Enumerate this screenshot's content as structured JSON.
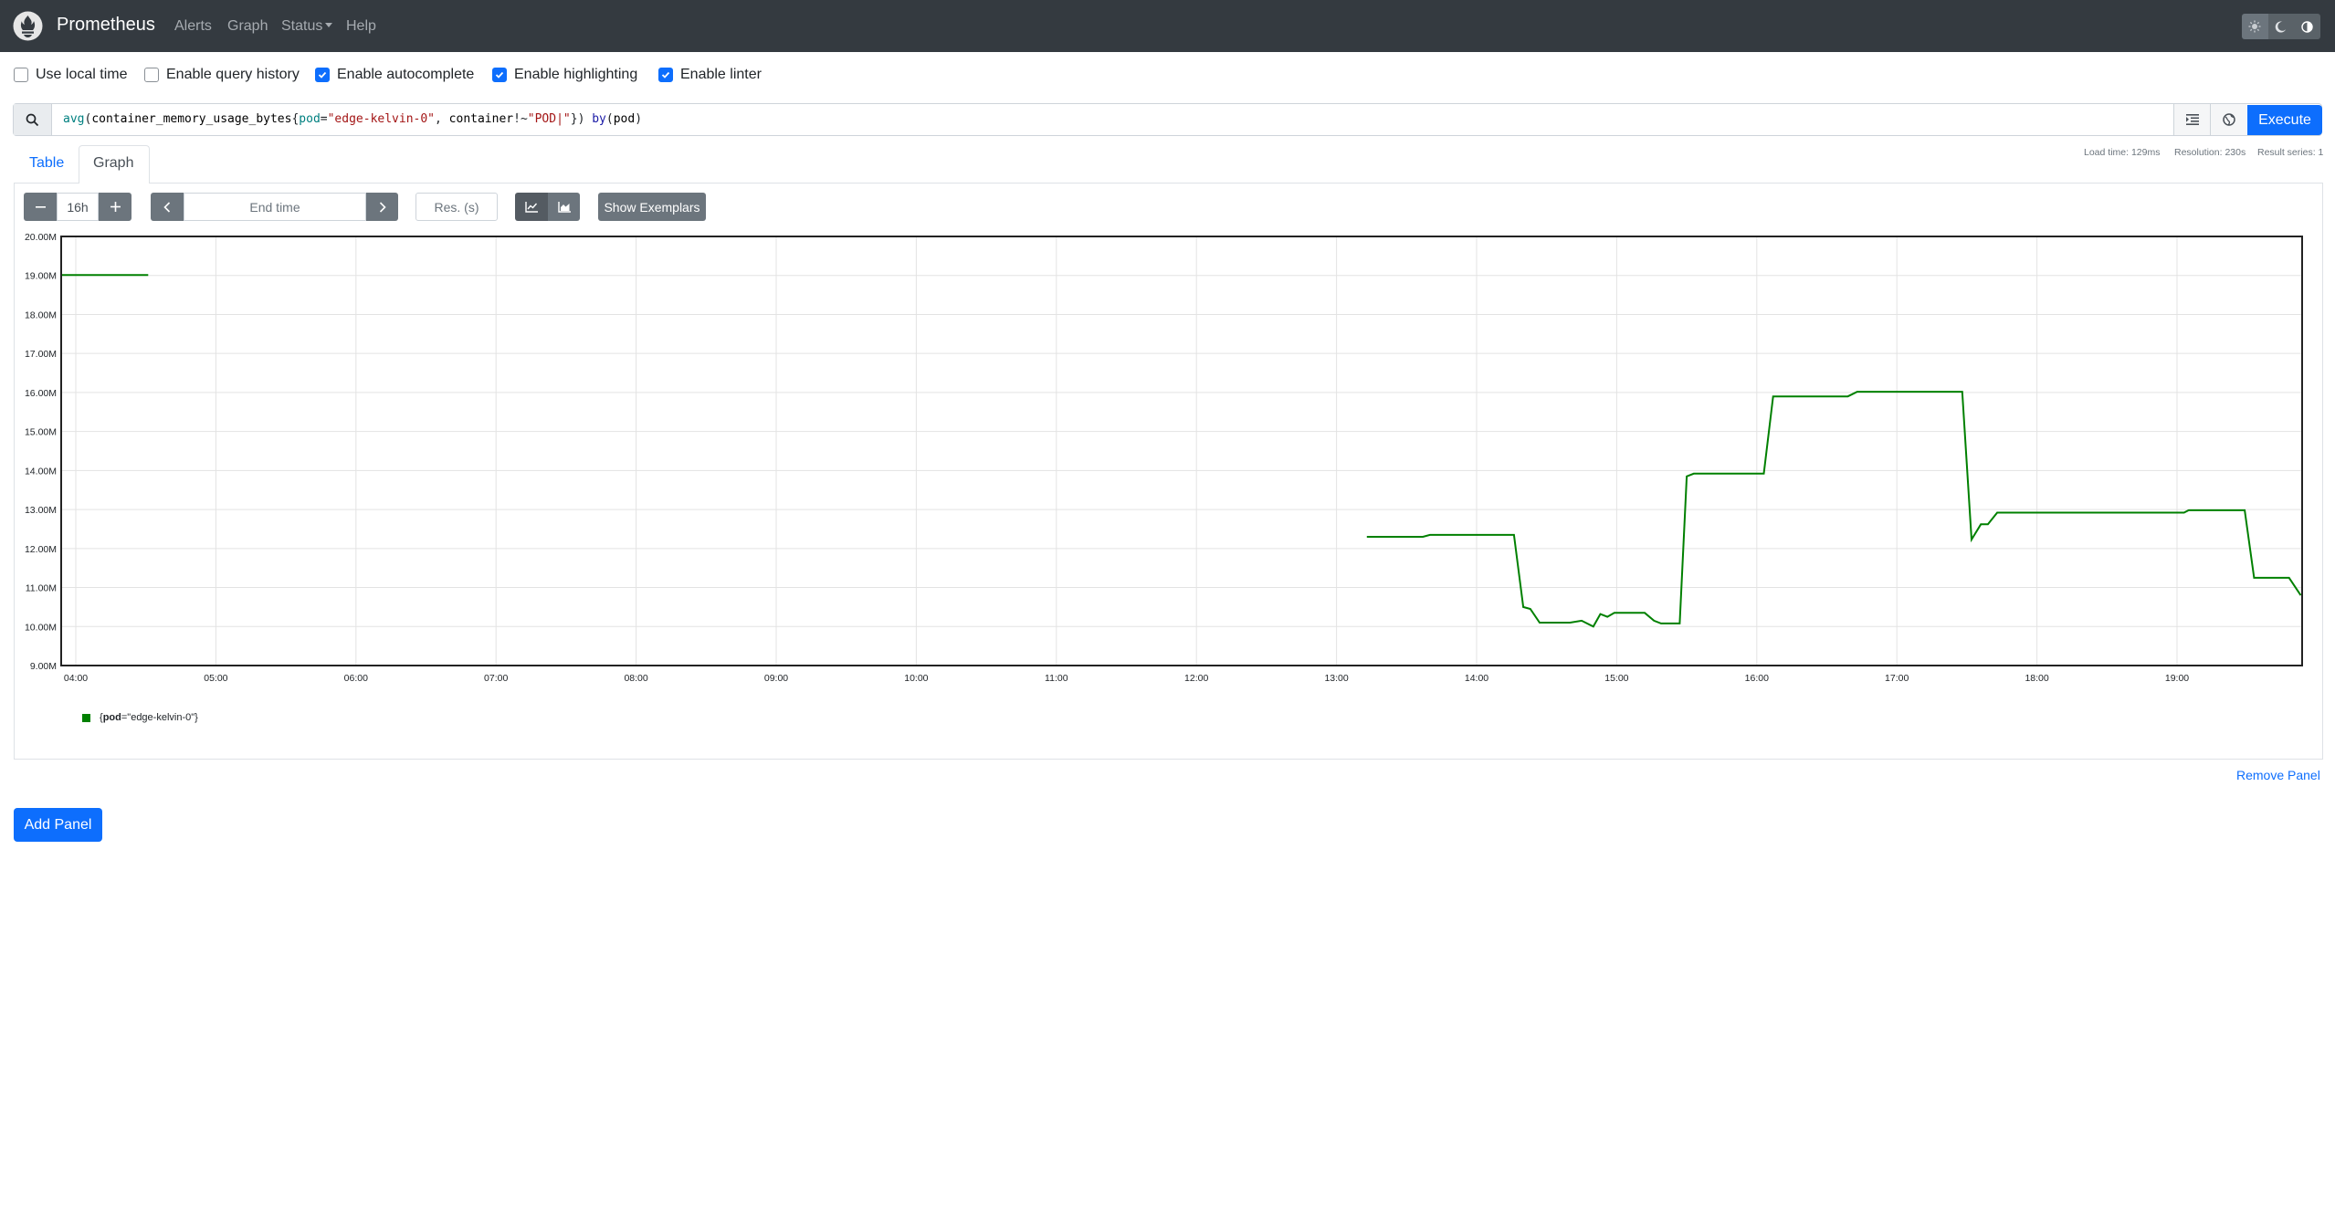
{
  "app": {
    "title": "Prometheus",
    "nav": [
      {
        "label": "Alerts"
      },
      {
        "label": "Graph"
      },
      {
        "label": "Status"
      },
      {
        "label": "Help"
      }
    ]
  },
  "options": [
    {
      "label": "Use local time",
      "checked": false
    },
    {
      "label": "Enable query history",
      "checked": false
    },
    {
      "label": "Enable autocomplete",
      "checked": true
    },
    {
      "label": "Enable highlighting",
      "checked": true
    },
    {
      "label": "Enable linter",
      "checked": true
    }
  ],
  "query": {
    "fn": "avg",
    "metric": "container_memory_usage_bytes",
    "label1": "pod",
    "value1": "\"edge-kelvin-0\"",
    "label2": "container",
    "op2": "!~",
    "value2": "\"POD|\"",
    "kw": "by",
    "group": "pod"
  },
  "execute_label": "Execute",
  "stats": {
    "load_time": "Load time: 129ms",
    "resolution": "Resolution: 230s",
    "result_series": "Result series: 1"
  },
  "tabs": [
    {
      "label": "Table"
    },
    {
      "label": "Graph"
    }
  ],
  "controls": {
    "range": "16h",
    "end_time_placeholder": "End time",
    "resolution_placeholder": "Res. (s)",
    "exemplars_label": "Show Exemplars"
  },
  "colors": {
    "series": "#008000",
    "accent": "#0d6efd",
    "navbar": "#343a40"
  },
  "chart_data": {
    "type": "line",
    "yticks": [
      "9.00M",
      "10.00M",
      "11.00M",
      "12.00M",
      "13.00M",
      "14.00M",
      "15.00M",
      "16.00M",
      "17.00M",
      "18.00M",
      "19.00M",
      "20.00M"
    ],
    "xticks": [
      "04:00",
      "05:00",
      "06:00",
      "07:00",
      "08:00",
      "09:00",
      "10:00",
      "11:00",
      "12:00",
      "13:00",
      "14:00",
      "15:00",
      "16:00",
      "17:00",
      "18:00",
      "19:00"
    ],
    "ylim": [
      9000000,
      20000000
    ],
    "grid": true,
    "legend": "bottom-left",
    "series": [
      {
        "name": "{pod=\"edge-kelvin-0\"}",
        "label_key": "pod",
        "label_value": "\"edge-kelvin-0\"",
        "segments": [
          [
            [
              "03:53",
              19010000
            ],
            [
              "04:31",
              19010000
            ]
          ],
          [
            [
              "13:13",
              12300000
            ],
            [
              "13:37",
              12300000
            ],
            [
              "13:40",
              12350000
            ],
            [
              "14:16",
              12350000
            ],
            [
              "14:20",
              10500000
            ],
            [
              "14:23",
              10450000
            ],
            [
              "14:27",
              10100000
            ],
            [
              "14:40",
              10100000
            ],
            [
              "14:45",
              10150000
            ],
            [
              "14:50",
              10000000
            ],
            [
              "14:53",
              10320000
            ],
            [
              "14:56",
              10250000
            ],
            [
              "14:59",
              10350000
            ],
            [
              "15:12",
              10350000
            ],
            [
              "15:16",
              10150000
            ],
            [
              "15:19",
              10080000
            ],
            [
              "15:27",
              10080000
            ],
            [
              "15:30",
              13850000
            ],
            [
              "15:33",
              13920000
            ],
            [
              "16:03",
              13920000
            ],
            [
              "16:07",
              15900000
            ],
            [
              "16:39",
              15900000
            ],
            [
              "16:43",
              16020000
            ],
            [
              "17:28",
              16020000
            ],
            [
              "17:32",
              12230000
            ],
            [
              "17:36",
              12620000
            ],
            [
              "17:39",
              12620000
            ],
            [
              "17:43",
              12920000
            ],
            [
              "19:03",
              12920000
            ],
            [
              "19:05",
              12980000
            ],
            [
              "19:29",
              12980000
            ],
            [
              "19:33",
              11250000
            ],
            [
              "19:48",
              11250000
            ],
            [
              "19:53",
              10800000
            ]
          ]
        ]
      }
    ]
  }
}
